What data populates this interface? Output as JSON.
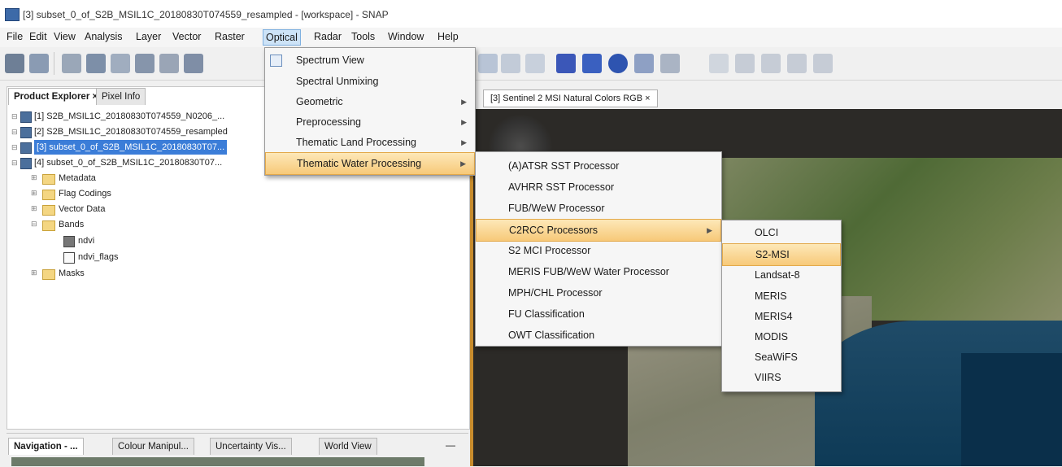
{
  "window": {
    "title": "[3] subset_0_of_S2B_MSIL1C_20180830T074559_resampled - [workspace] - SNAP"
  },
  "menubar": {
    "items": [
      "File",
      "Edit",
      "View",
      "Analysis",
      "Layer",
      "Vector",
      "Raster",
      "Optical",
      "Radar",
      "Tools",
      "Window",
      "Help"
    ]
  },
  "left_panel": {
    "tabs": [
      "Product Explorer ×",
      "Pixel Info"
    ],
    "products": [
      "[1] S2B_MSIL1C_20180830T074559_N0206_...",
      "[2] S2B_MSIL1C_20180830T074559_resampled",
      "[3] subset_0_of_S2B_MSIL1C_20180830T07...",
      "[4] subset_0_of_S2B_MSIL1C_20180830T07..."
    ],
    "folders": [
      "Metadata",
      "Flag Codings",
      "Vector Data",
      "Bands"
    ],
    "bands": [
      "ndvi",
      "ndvi_flags"
    ],
    "masks_label": "Masks"
  },
  "nav_panel": {
    "tabs": [
      "Navigation - ...",
      "Colour Manipul...",
      "Uncertainty Vis...",
      "World View"
    ],
    "minimize": "—"
  },
  "view_tab": "[3] Sentinel 2 MSI Natural Colors RGB ×",
  "optical_menu": {
    "items": [
      "Spectrum View",
      "Spectral Unmixing",
      "Geometric",
      "Preprocessing",
      "Thematic Land Processing",
      "Thematic Water Processing"
    ]
  },
  "water_menu": {
    "items": [
      "(A)ATSR SST Processor",
      "AVHRR SST Processor",
      "FUB/WeW Processor",
      "C2RCC Processors",
      "S2 MCI Processor",
      "MERIS FUB/WeW Water Processor",
      "MPH/CHL Processor",
      "FU Classification",
      "OWT Classification"
    ]
  },
  "c2rcc_menu": {
    "items": [
      "OLCI",
      "S2-MSI",
      "Landsat-8",
      "MERIS",
      "MERIS4",
      "MODIS",
      "SeaWiFS",
      "VIIRS"
    ]
  },
  "colors": {
    "highlight": "#f7c979",
    "selection": "#3b7dd8"
  }
}
